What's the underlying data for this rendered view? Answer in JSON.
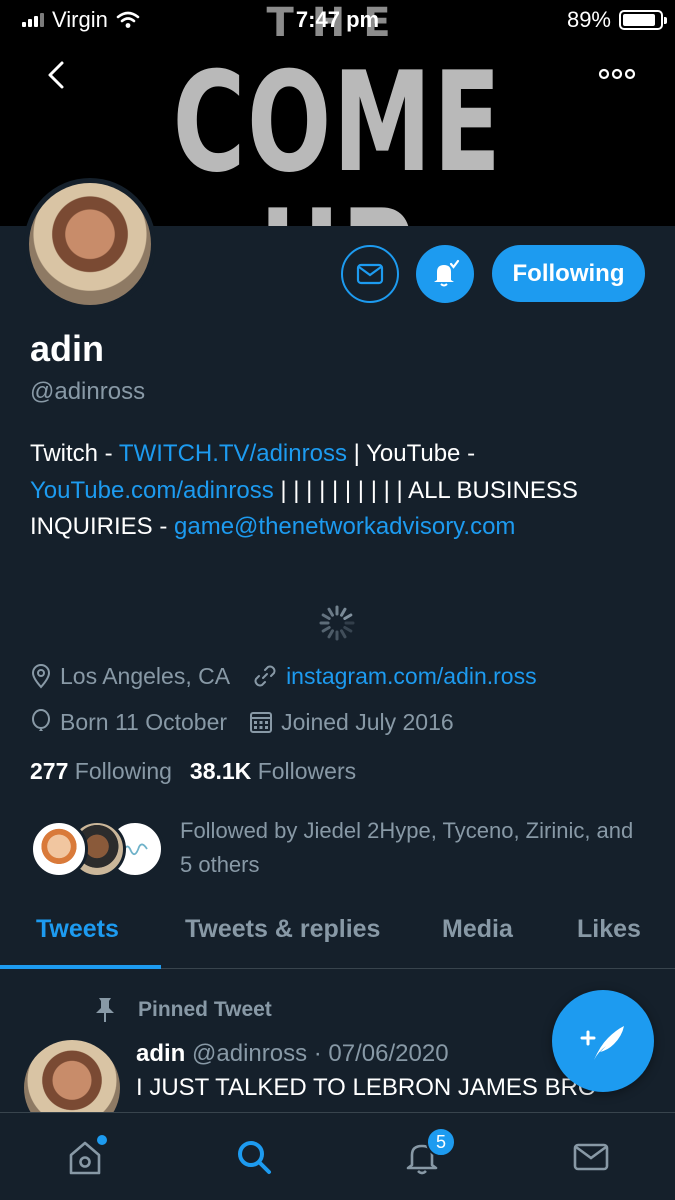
{
  "status_bar": {
    "carrier": "Virgin",
    "time": "7:47 pm",
    "battery_percent": "89%",
    "battery_level": 0.89
  },
  "banner": {
    "line1": "THE",
    "line2": "COME UP"
  },
  "profile": {
    "name": "adin",
    "handle": "@adinross",
    "bio": {
      "part1": "Twitch - ",
      "link1": "TWITCH.TV/adinross",
      "part2": " | YouTube - ",
      "link2": "YouTube.com/adinross",
      "part3": " | | | | | | | | | | ALL BUSINESS INQUIRIES - ",
      "link3": "game@thenetworkadvisory.com"
    },
    "location": "Los Angeles, CA",
    "website": "instagram.com/adin.ross",
    "born": "Born 11 October",
    "joined": "Joined July 2016",
    "following_count": "277",
    "following_label": "Following",
    "followers_count": "38.1K",
    "followers_label": "Followers",
    "followed_by": "Followed by Jiedel 2Hype, Tyceno, Zirinic, and 5 others"
  },
  "actions": {
    "following_button": "Following"
  },
  "tabs": [
    {
      "label": "Tweets",
      "active": true
    },
    {
      "label": "Tweets & replies",
      "active": false
    },
    {
      "label": "Media",
      "active": false
    },
    {
      "label": "Likes",
      "active": false
    }
  ],
  "pinned_tweet": {
    "pinned_label": "Pinned Tweet",
    "author": "adin",
    "meta": "@adinross · 07/06/2020",
    "text": "I JUST TALKED TO LEBRON JAMES BRO"
  },
  "bottom_nav": {
    "notification_count": "5"
  },
  "colors": {
    "background": "#15202b",
    "accent": "#1d9bf0",
    "secondary_text": "#8899a6"
  }
}
